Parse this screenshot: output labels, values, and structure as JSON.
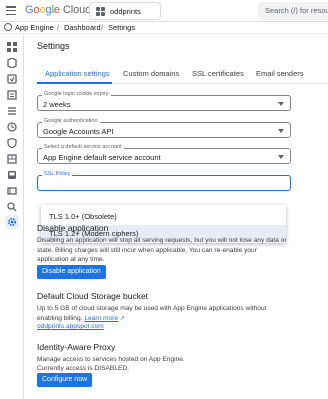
{
  "header": {
    "logo_letters": [
      "G",
      "o",
      "o",
      "g",
      "l",
      "e"
    ],
    "logo_word": "Cloud",
    "project": "oddprints",
    "search_placeholder": "Search (/) for resources"
  },
  "breadcrumb": [
    "App Engine",
    "Dashboard",
    "Settings"
  ],
  "page_title": "Settings",
  "tabs": [
    "Application settings",
    "Custom domains",
    "SSL certificates",
    "Email senders"
  ],
  "fields": [
    {
      "label": "Google login cookie expiry",
      "value": "2 weeks"
    },
    {
      "label": "Google authentication",
      "value": "Google Accounts API"
    },
    {
      "label": "Select a default service account",
      "value": "App Engine default service account"
    },
    {
      "label": "SSL Policy",
      "value": ""
    }
  ],
  "ssl_options": [
    "TLS 1.0+ (Obsolete)",
    "TLS 1.2+ (Modern ciphers)"
  ],
  "disable_app": {
    "title": "Disable application",
    "text": "Disabling an application will stop all serving requests, but you will not lose any data or state. Billing charges will still incur when applicable. You can re-enable your application at any time.",
    "button": "Disable application"
  },
  "storage": {
    "title": "Default Cloud Storage bucket",
    "text": "Up to 5 GB of cloud storage may be used with App Engine applications without enabling billing.",
    "learn_more": "Learn more",
    "bucket": "oddprints.appspot.com"
  },
  "iap": {
    "title": "Identity-Aware Proxy",
    "line1": "Manage access to services hosted on App Engine.",
    "line2": "Currently access is DISABLED.",
    "button": "Configure now"
  },
  "colors": {
    "accent": "#1a73e8",
    "selected_option_bg": "#e8eaf6"
  },
  "rail_icons": [
    "dashboard-icon",
    "services-icon",
    "versions-icon",
    "instances-icon",
    "task-queues-icon",
    "cron-jobs-icon",
    "security-scans-icon",
    "firewall-icon",
    "quotas-icon",
    "memcache-icon",
    "search-icon",
    "settings-icon"
  ]
}
